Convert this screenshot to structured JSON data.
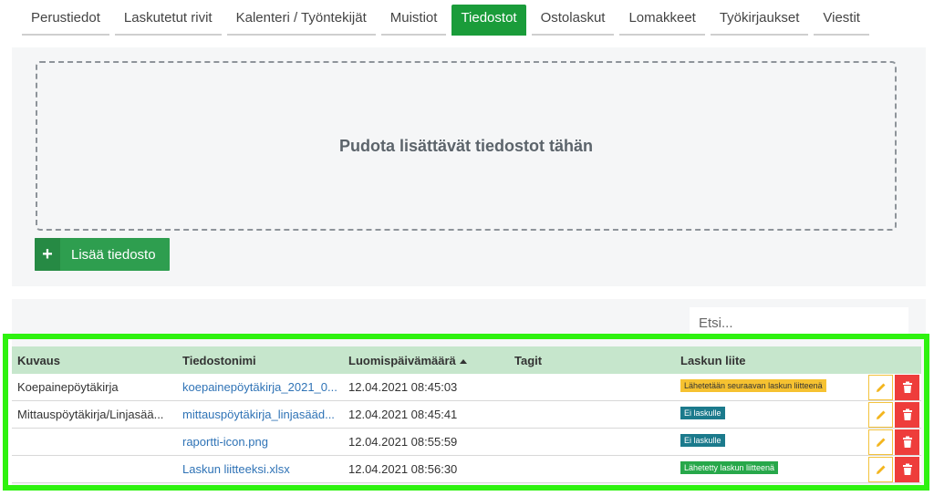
{
  "tabs": [
    {
      "label": "Perustiedot"
    },
    {
      "label": "Laskutetut rivit"
    },
    {
      "label": "Kalenteri / Työntekijät"
    },
    {
      "label": "Muistiot"
    },
    {
      "label": "Tiedostot",
      "active": true
    },
    {
      "label": "Ostolaskut"
    },
    {
      "label": "Lomakkeet"
    },
    {
      "label": "Työkirjaukset"
    },
    {
      "label": "Viestit"
    }
  ],
  "upload": {
    "dropzone_text": "Pudota lisättävät tiedostot tähän",
    "add_button_label": "Lisää tiedosto"
  },
  "search": {
    "placeholder": "Etsi..."
  },
  "table": {
    "headers": {
      "kuvaus": "Kuvaus",
      "tiedostonimi": "Tiedostonimi",
      "luomispaivamaara": "Luomispäivämäärä",
      "tagit": "Tagit",
      "laskun_liite": "Laskun liite"
    },
    "rows": [
      {
        "kuvaus": "Koepainepöytäkirja",
        "tiedostonimi": "koepainepöytäkirja_2021_0...",
        "pvm": "12.04.2021 08:45:03",
        "tagit": "",
        "liite": "Lähetetään seuraavan laskun liitteenä",
        "liite_color": "#f6c231"
      },
      {
        "kuvaus": "Mittauspöytäkirja/Linjasää...",
        "tiedostonimi": "mittauspöytäkirja_linjasääd...",
        "pvm": "12.04.2021 08:45:41",
        "tagit": "",
        "liite": "Ei laskulle",
        "liite_color": "#1b7a8c"
      },
      {
        "kuvaus": "",
        "tiedostonimi": "raportti-icon.png",
        "pvm": "12.04.2021 08:55:59",
        "tagit": "",
        "liite": "Ei laskulle",
        "liite_color": "#1b7a8c"
      },
      {
        "kuvaus": "",
        "tiedostonimi": "Laskun liitteeksi.xlsx",
        "pvm": "12.04.2021 08:56:30",
        "tagit": "",
        "liite": "Lähetetty laskun liitteenä",
        "liite_color": "#27a84a"
      }
    ]
  },
  "colors": {
    "accent": "#1a9c3a",
    "highlight": "#2ef20f",
    "header_bg": "#c6e6cc",
    "delete": "#ee3d3b",
    "edit_border": "#f3c23d"
  },
  "icons": {
    "add": "plus-icon",
    "edit": "pencil-icon",
    "delete": "trash-icon",
    "sort": "sort-asc-icon"
  }
}
